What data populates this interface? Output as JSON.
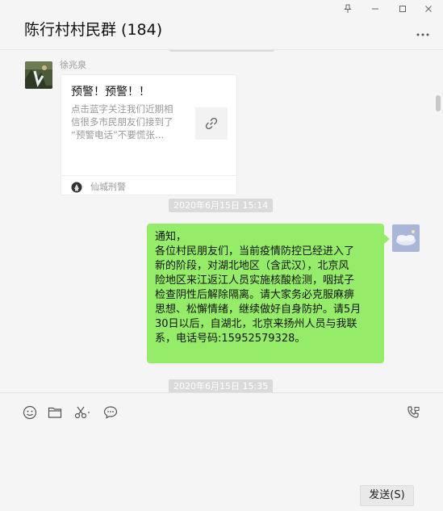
{
  "header": {
    "chat_title": "陈行村村民群 (184)",
    "pin_icon": "pin-icon",
    "minimize_icon": "minimize-icon",
    "maximize_icon": "maximize-icon",
    "close_icon": "close-icon",
    "more_icon": "more-icon"
  },
  "messages": {
    "card_message": {
      "sender": "徐兆泉",
      "card_title": "预警！预警！！",
      "card_desc_lines": [
        "点击蓝字关注我们近期相",
        "信很多市民朋友们接到了",
        "“预警电话”不要慌张…"
      ],
      "source_name": "仙城刑警",
      "link_icon": "link-icon"
    },
    "timestamp_1": "2020年6月15日 15:14",
    "text_message": {
      "lines": [
        "通知，",
        "各位村民朋友们，当前疫情防控已经进入了",
        "新的阶段，对湖北地区（含武汉），北京风",
        "险地区来江返江人员实施核酸检测，咽拭子",
        "检查阴性后解除隔离。请大家务必克服麻痹",
        "思想、松懈情绪，继续做好自身防护。请5月",
        "30日以后，自湖北，北京来扬州人员与我联",
        "系，电话号码:15952579328。"
      ]
    },
    "timestamp_2": "2020年6月15日 15:35"
  },
  "toolbar": {
    "emoji_icon": "emoji-icon",
    "folder_icon": "folder-icon",
    "scissors_icon": "scissors-icon",
    "chat_bubble_icon": "chat-bubble-icon",
    "phone_icon": "phone-icon"
  },
  "input": {
    "send_label": "发送(S)"
  },
  "colors": {
    "bubble_green": "#95ec69",
    "background": "#f5f5f5",
    "timestamp_bg": "#dadada"
  }
}
